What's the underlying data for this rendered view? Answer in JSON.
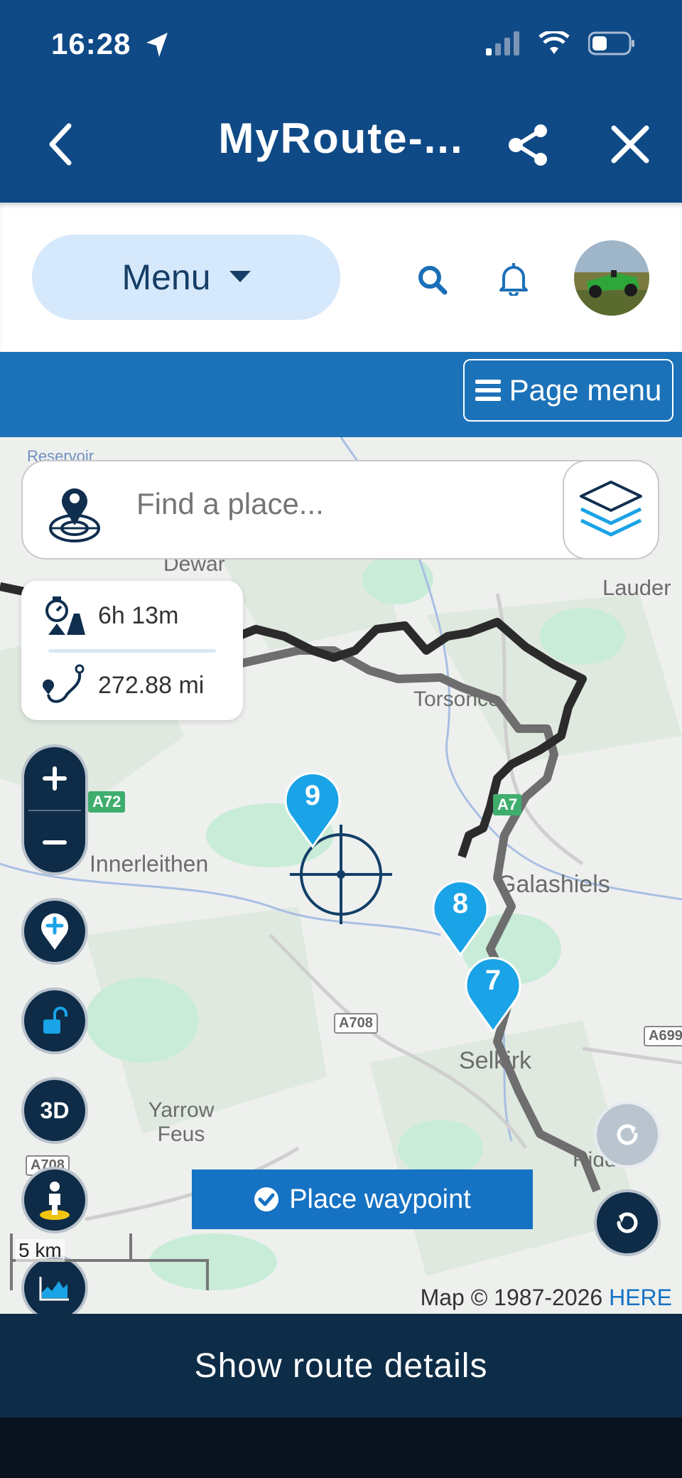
{
  "status": {
    "time": "16:28"
  },
  "header": {
    "title": "MyRoute-..."
  },
  "nav": {
    "menu_label": "Menu"
  },
  "strip": {
    "page_menu_label": "Page menu"
  },
  "search": {
    "placeholder": "Find a place..."
  },
  "stats": {
    "duration": "6h 13m",
    "distance": "272.88 mi"
  },
  "map": {
    "places": [
      "Dewar",
      "Lauder",
      "Torsonce",
      "Innerleithen",
      "Galashiels",
      "Selkirk",
      "Yarrow Feus",
      "Riddell",
      "Reservoir"
    ],
    "roads": [
      "A7",
      "A708",
      "A708",
      "A699",
      "A72"
    ],
    "waypoints": [
      "9",
      "8",
      "7"
    ],
    "place_waypoint_label": "Place waypoint",
    "attribution_prefix": "Map © 1987-2026 ",
    "attribution_link": "HERE",
    "scale_label": "5 km",
    "threed_label": "3D"
  },
  "footer": {
    "show_route_label": "Show route details"
  },
  "colors": {
    "header": "#0f4a87",
    "accent": "#1672c3",
    "waypoint": "#1aa3e6",
    "route": "#2b2b2b"
  }
}
